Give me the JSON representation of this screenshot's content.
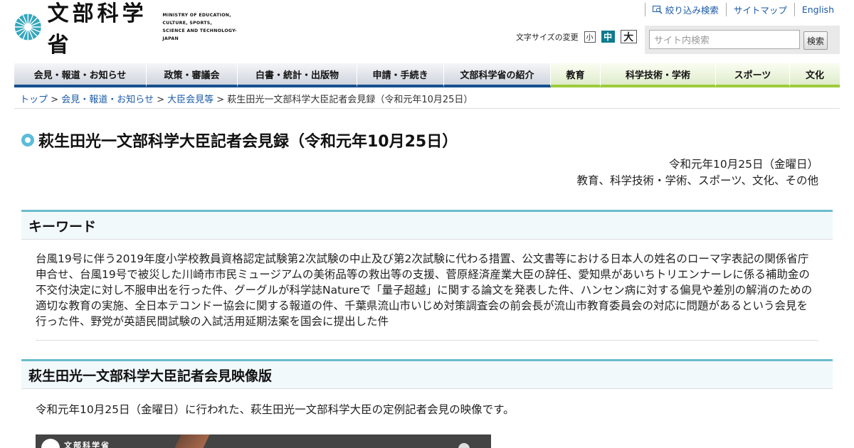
{
  "logo": {
    "ja": "文部科学省",
    "en": [
      "MINISTRY OF EDUCATION,",
      "CULTURE, SPORTS,",
      "SCIENCE AND TECHNOLOGY-JAPAN"
    ]
  },
  "util_links": [
    "絞り込み検索",
    "サイトマップ",
    "English"
  ],
  "font_size": {
    "label": "文字サイズの変更",
    "small": "小",
    "medium": "中",
    "large": "大",
    "selected": "中"
  },
  "search": {
    "placeholder": "サイト内検索",
    "button": "検索"
  },
  "nav": [
    "会見・報道・お知らせ",
    "政策・審議会",
    "白書・統計・出版物",
    "申請・手続き",
    "文部科学省の紹介",
    "教育",
    "科学技術・学術",
    "スポーツ",
    "文化"
  ],
  "breadcrumb": {
    "items": [
      "トップ",
      "会見・報道・お知らせ",
      "大臣会見等"
    ],
    "sep": ">",
    "current": "萩生田光一文部科学大臣記者会見録（令和元年10月25日）"
  },
  "title": "萩生田光一文部科学大臣記者会見録（令和元年10月25日）",
  "meta": {
    "date": "令和元年10月25日（金曜日）",
    "categories": "教育、科学技術・学術、スポーツ、文化、その他"
  },
  "keywords": {
    "heading": "キーワード",
    "body": "台風19号に伴う2019年度小学校教員資格認定試験第2次試験の中止及び第2次試験に代わる措置、公文書等における日本人の姓名のローマ字表記の関係省庁申合せ、台風19号で被災した川崎市市民ミュージアムの美術品等の救出等の支援、菅原経済産業大臣の辞任、愛知県があいちトリエンナーレに係る補助金の不交付決定に対し不服申出を行った件、グーグルが科学誌Natureで「量子超越」に関する論文を発表した件、ハンセン病に対する偏見や差別の解消のための適切な教育の実施、全日本テコンドー協会に関する報道の件、千葉県流山市いじめ対策調査会の前会長が流山市教育委員会の対応に問題があるという会見を行った件、野党が英語民間試験の入試活用延期法案を国会に提出した件"
  },
  "video_section": {
    "heading": "萩生田光一文部科学大臣記者会見映像版",
    "text": "令和元年10月25日（金曜日）に行われた、萩生田光一文部科学大臣の定例記者会見の映像です。",
    "thumb_text": "文部科学省"
  },
  "colors": {
    "nav_blue": "#14508f",
    "nav_green": "#9ccc3a",
    "accent_teal": "#6bbccd",
    "fs_selected": "#0e7b8f"
  }
}
